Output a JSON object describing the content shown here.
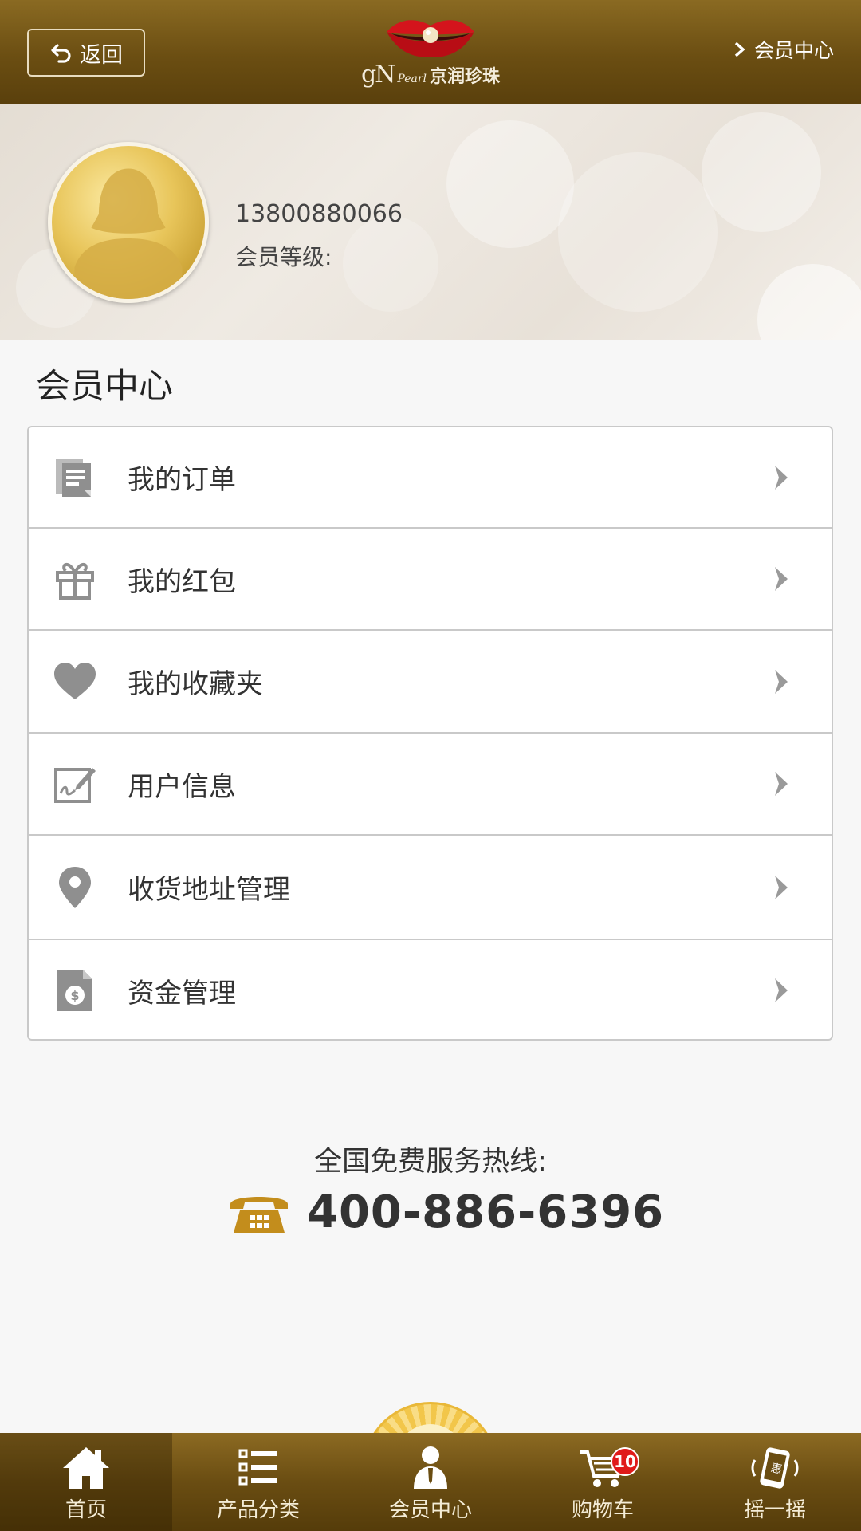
{
  "header": {
    "back_label": "返回",
    "logo_gn": "gN",
    "logo_pearl": "Pearl",
    "logo_cn": "京润珍珠",
    "right_label": "会员中心"
  },
  "profile": {
    "phone": "13800880066",
    "level_label": "会员等级:"
  },
  "section_title": "会员中心",
  "menu": {
    "items": [
      {
        "label": "我的订单",
        "icon": "orders-icon"
      },
      {
        "label": "我的红包",
        "icon": "gift-icon"
      },
      {
        "label": "我的收藏夹",
        "icon": "heart-icon"
      },
      {
        "label": "用户信息",
        "icon": "edit-profile-icon"
      },
      {
        "label": "收货地址管理",
        "icon": "location-pin-icon"
      },
      {
        "label": "资金管理",
        "icon": "money-document-icon"
      }
    ]
  },
  "hotline": {
    "label": "全国免费服务热线:",
    "number": "400-886-6396"
  },
  "tabs": [
    {
      "label": "首页",
      "icon": "home-icon"
    },
    {
      "label": "产品分类",
      "icon": "category-list-icon"
    },
    {
      "label": "会员中心",
      "icon": "member-icon"
    },
    {
      "label": "购物车",
      "icon": "cart-icon",
      "badge": "10"
    },
    {
      "label": "摇一摇",
      "icon": "shake-phone-icon",
      "glyph": "惠"
    }
  ],
  "colors": {
    "header_brown": "#6b4e12",
    "gold_accent": "#c9a032",
    "badge_red": "#e01a1a"
  }
}
